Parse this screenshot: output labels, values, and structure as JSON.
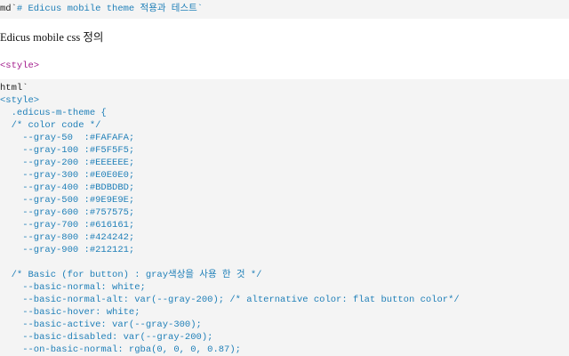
{
  "markdown_cell": {
    "prefix": "md`",
    "text": "# Edicus mobile theme 적용과 테스트`"
  },
  "heading": "Edicus mobile css 정의",
  "style_output": "<style>",
  "code_cell": {
    "lines": [
      {
        "text": "html`",
        "tone": "dark"
      },
      {
        "text": "<style>",
        "tone": "code"
      },
      {
        "text": "  .edicus-m-theme {",
        "tone": "code"
      },
      {
        "text": "  /* color code */",
        "tone": "code"
      },
      {
        "text": "    --gray-50  :#FAFAFA;",
        "tone": "code"
      },
      {
        "text": "    --gray-100 :#F5F5F5;",
        "tone": "code"
      },
      {
        "text": "    --gray-200 :#EEEEEE;",
        "tone": "code"
      },
      {
        "text": "    --gray-300 :#E0E0E0;",
        "tone": "code"
      },
      {
        "text": "    --gray-400 :#BDBDBD;",
        "tone": "code"
      },
      {
        "text": "    --gray-500 :#9E9E9E;",
        "tone": "code"
      },
      {
        "text": "    --gray-600 :#757575;",
        "tone": "code"
      },
      {
        "text": "    --gray-700 :#616161;",
        "tone": "code"
      },
      {
        "text": "    --gray-800 :#424242;",
        "tone": "code"
      },
      {
        "text": "    --gray-900 :#212121;",
        "tone": "code"
      },
      {
        "text": "",
        "tone": "code"
      },
      {
        "text": "  /* Basic (for button) : gray색상을 사용 한 것 */",
        "tone": "code"
      },
      {
        "text": "    --basic-normal: white;",
        "tone": "code"
      },
      {
        "text": "    --basic-normal-alt: var(--gray-200); /* alternative color: flat button color*/",
        "tone": "code"
      },
      {
        "text": "    --basic-hover: white;",
        "tone": "code"
      },
      {
        "text": "    --basic-active: var(--gray-300);",
        "tone": "code"
      },
      {
        "text": "    --basic-disabled: var(--gray-200);",
        "tone": "code"
      },
      {
        "text": "    --on-basic-normal: rgba(0, 0, 0, 0.87);",
        "tone": "code"
      }
    ]
  },
  "colors": {
    "cell_background": "#f4f4f4",
    "code_text": "#1f7fb8",
    "tag_output": "#a31c8c",
    "plain_text": "#222222"
  }
}
